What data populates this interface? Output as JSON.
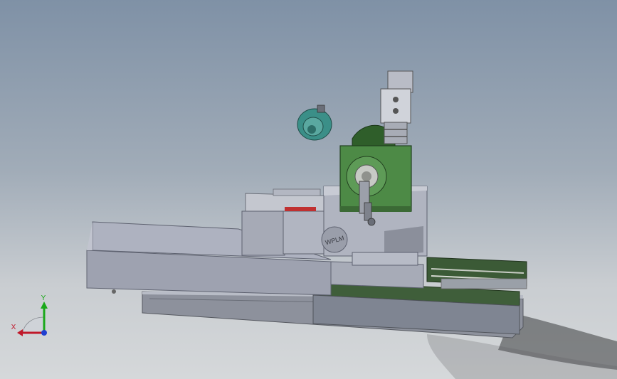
{
  "viewport": {
    "background_top": "#7f91a6",
    "background_bottom": "#d5d8da"
  },
  "model": {
    "body_color": "#a4a8b4",
    "rail_color": "#3a5a38",
    "spindle_color": "#4e8a48",
    "chuck_color": "#3b8f88",
    "head_badge_text": "WPLM"
  },
  "triad": {
    "x_label": "X",
    "y_label": "Y",
    "x_color": "#c0182a",
    "y_color": "#1aa81a",
    "z_color": "#1f3fd0"
  }
}
